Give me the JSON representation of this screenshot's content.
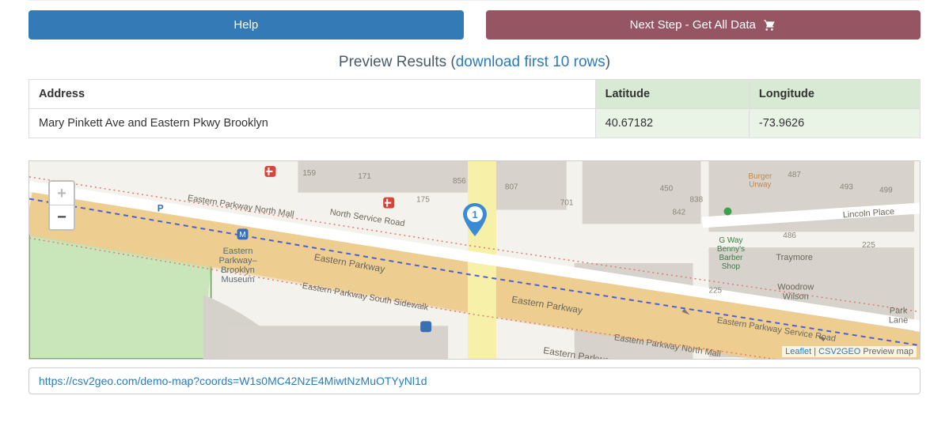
{
  "buttons": {
    "help": "Help",
    "next": "Next Step - Get All Data"
  },
  "preview": {
    "title_prefix": "Preview Results (",
    "link_text": "download first 10 rows",
    "title_suffix": ")"
  },
  "table": {
    "headers": {
      "address": "Address",
      "lat": "Latitude",
      "lon": "Longitude"
    },
    "row": {
      "address": "Mary Pinkett Ave and Eastern Pkwy Brooklyn",
      "lat": "40.67182",
      "lon": "-73.9626"
    }
  },
  "map": {
    "zoom_in": "+",
    "zoom_out": "−",
    "marker_label": "1",
    "attribution": {
      "leaflet": "Leaflet",
      "sep": " | ",
      "csv2geo": "CSV2GEO",
      "tail": " Preview map"
    },
    "labels": {
      "epnm": "Eastern Parkway North Mall",
      "nsr": "North Service Road",
      "ep1": "Eastern Parkway",
      "epss": "Eastern Parkway South Sidewalk",
      "ep2": "Eastern Parkway",
      "ep3": "Eastern Parkway",
      "epnm2": "Eastern Parkway North Mall",
      "epsr": "Eastern Parkway Service Road",
      "lincoln": "Lincoln Place",
      "museum": "Eastern Parkway–Brooklyn Museum",
      "burger": "Burger Urway",
      "gway": "G Way Benny's Barber Shop",
      "traymore": "Traymore",
      "woodrow": "Woodrow Wilson",
      "parklane": "Park Lane",
      "n159": "159",
      "n175": "175",
      "n171": "171",
      "n856": "856",
      "n807": "807",
      "n701": "701",
      "n450": "450",
      "n838": "838",
      "n842": "842",
      "n487": "487",
      "n493": "493",
      "n499": "499",
      "n486": "486",
      "n225": "225",
      "n225b": "225"
    }
  },
  "url": "https://csv2geo.com/demo-map?coords=W1s0MC42NzE4MiwtNzMuOTYyNl1d"
}
